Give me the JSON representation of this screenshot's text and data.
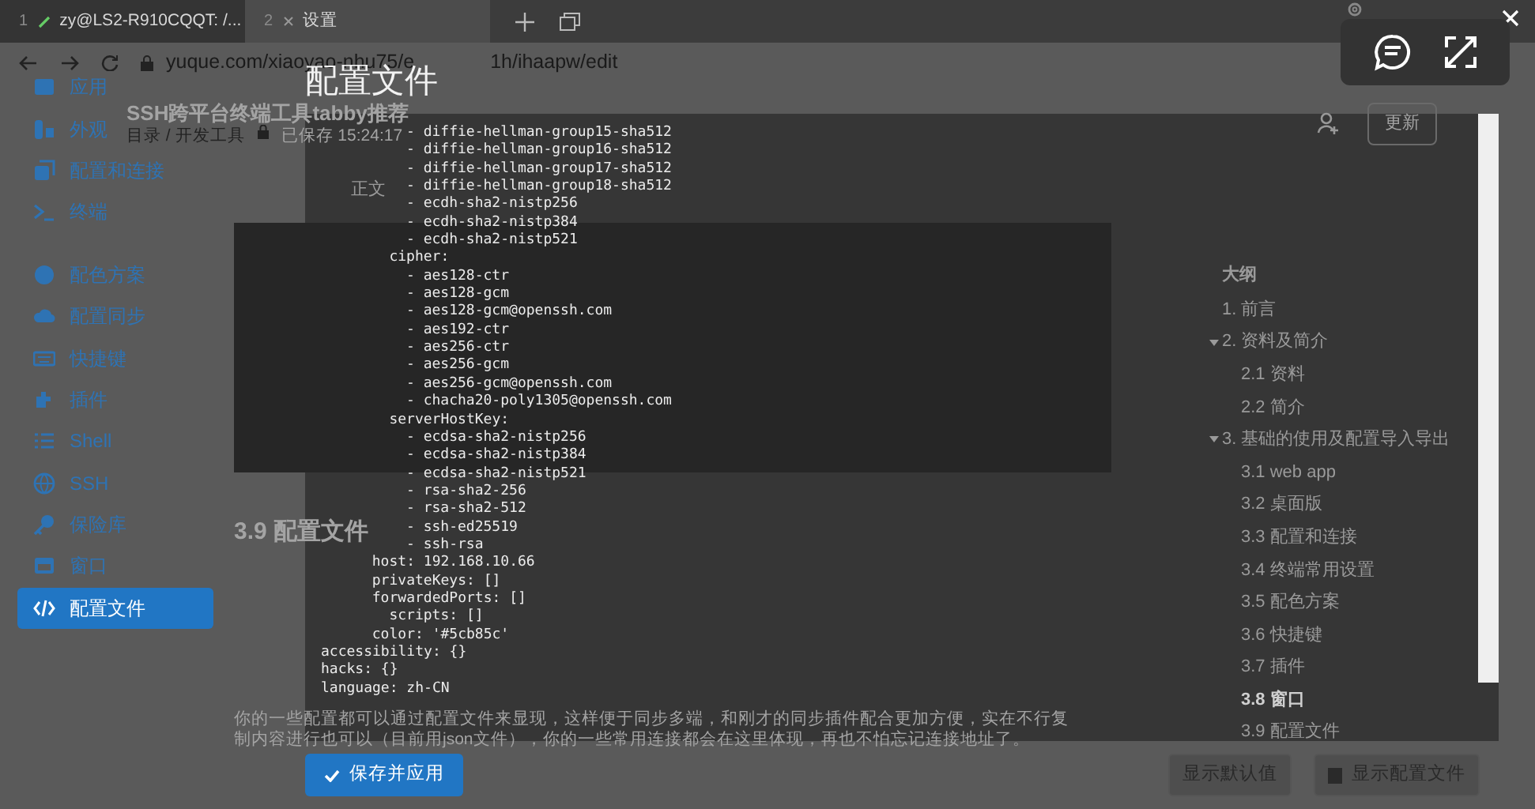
{
  "window_tabs": [
    {
      "number": "1",
      "label": "zy@LS2-R910CQQT: /...",
      "selected": false
    },
    {
      "number": "2",
      "label": "设置",
      "selected": true
    }
  ],
  "browser": {
    "url_start": "yuque.com/xiaoyao-nhu75/e",
    "url_end": "1h/ihaapw/edit"
  },
  "document": {
    "title": "SSH跨平台终端工具tabby推荐",
    "breadcrumb": "目录 / 开发工具",
    "saved": "已保存 15:24:17",
    "update_button": "更新",
    "text_style": "正文",
    "heading": "3.9 配置文件",
    "paragraph": "你的一些配置都可以通过配置文件来显现，这样便于同步多端，和刚才的同步插件配合更加方便，实在不行复制内容进行也可以（目前用json文件），你的一些常用连接都会在这里体现，再也不怕忘记连接地址了。"
  },
  "outline": {
    "title": "大纲",
    "items": [
      {
        "label": "1. 前言",
        "selected": false
      },
      {
        "label": "2. 资料及简介",
        "selected": false,
        "expanded": true,
        "children": [
          {
            "label": "2.1 资料",
            "selected": false
          },
          {
            "label": "2.2 简介",
            "selected": false
          }
        ]
      },
      {
        "label": "3. 基础的使用及配置导入导出",
        "selected": false,
        "expanded": true,
        "children": [
          {
            "label": "3.1 web app",
            "selected": false
          },
          {
            "label": "3.2 桌面版",
            "selected": false
          },
          {
            "label": "3.3 配置和连接",
            "selected": false
          },
          {
            "label": "3.4 终端常用设置",
            "selected": false
          },
          {
            "label": "3.5 配色方案",
            "selected": false
          },
          {
            "label": "3.6 快捷键",
            "selected": false
          },
          {
            "label": "3.7 插件",
            "selected": false
          },
          {
            "label": "3.8 窗口",
            "selected": true
          },
          {
            "label": "3.9 配置文件",
            "selected": false
          }
        ]
      }
    ]
  },
  "sidebar": {
    "groups": [
      [
        {
          "label": "应用",
          "selected": false
        },
        {
          "label": "外观",
          "selected": false
        },
        {
          "label": "配置和连接",
          "selected": false
        },
        {
          "label": "终端",
          "selected": false
        }
      ],
      [
        {
          "label": "配色方案",
          "selected": false
        },
        {
          "label": "配置同步",
          "selected": false
        },
        {
          "label": "快捷键",
          "selected": false
        },
        {
          "label": "插件",
          "selected": false
        },
        {
          "label": "Shell",
          "selected": false
        },
        {
          "label": "SSH",
          "selected": false
        },
        {
          "label": "保险库",
          "selected": false
        },
        {
          "label": "窗口",
          "selected": false
        },
        {
          "label": "配置文件",
          "selected": true
        }
      ]
    ]
  },
  "config_modal": {
    "title": "配置文件",
    "code_lines": [
      "          - diffie-hellman-group15-sha512",
      "          - diffie-hellman-group16-sha512",
      "          - diffie-hellman-group17-sha512",
      "          - diffie-hellman-group18-sha512",
      "          - ecdh-sha2-nistp256",
      "          - ecdh-sha2-nistp384",
      "          - ecdh-sha2-nistp521",
      "        cipher:",
      "          - aes128-ctr",
      "          - aes128-gcm",
      "          - aes128-gcm@openssh.com",
      "          - aes192-ctr",
      "          - aes256-ctr",
      "          - aes256-gcm",
      "          - aes256-gcm@openssh.com",
      "          - chacha20-poly1305@openssh.com",
      "        serverHostKey:",
      "          - ecdsa-sha2-nistp256",
      "          - ecdsa-sha2-nistp384",
      "          - ecdsa-sha2-nistp521",
      "          - rsa-sha2-256",
      "          - rsa-sha2-512",
      "          - ssh-ed25519",
      "          - ssh-rsa",
      "      host: 192.168.10.66",
      "      privateKeys: []",
      "      forwardedPorts: []",
      "        scripts: []",
      "      color: '#5cb85c'",
      "accessibility: {}",
      "hacks: {}",
      "language: zh-CN"
    ],
    "save_button": "保存并应用",
    "footer_buttons": [
      {
        "label": "显示默认值",
        "kind": "plain"
      },
      {
        "label": "显示配置文件",
        "kind": "icon"
      }
    ]
  }
}
